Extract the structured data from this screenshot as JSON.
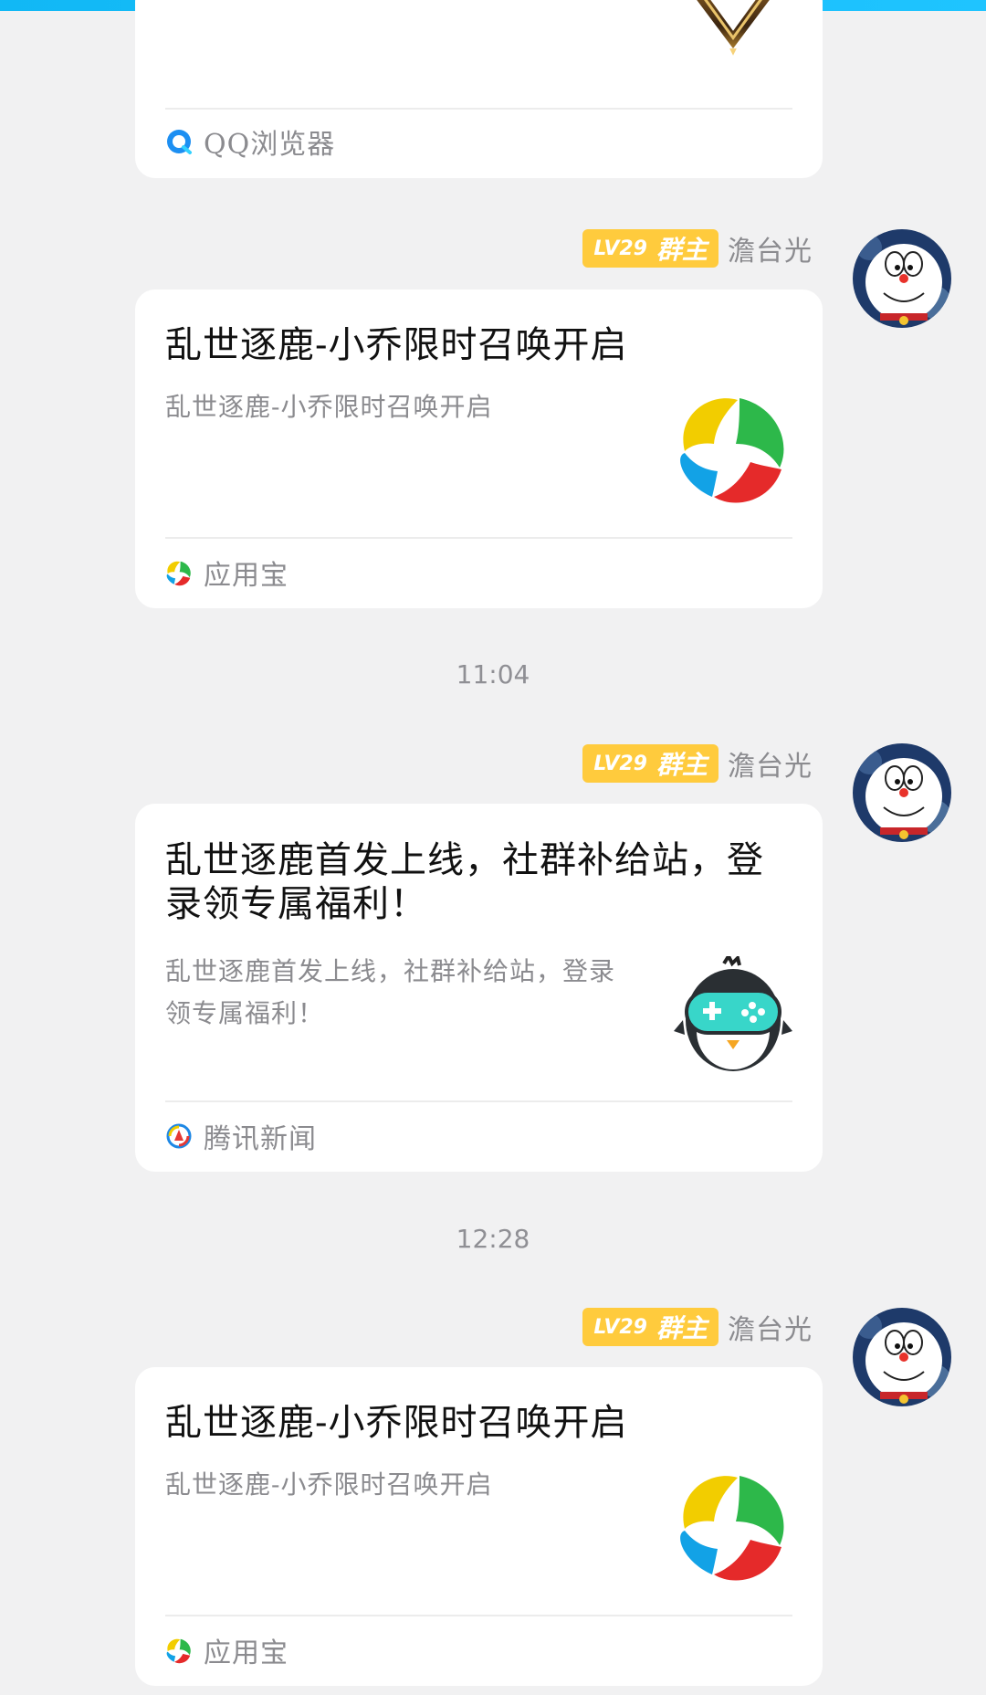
{
  "cards": [
    {
      "source": "QQ浏览器",
      "source_icon": "qq-browser-icon"
    },
    {
      "title": "乱世逐鹿-小乔限时召唤开启",
      "description": "乱世逐鹿-小乔限时召唤开启",
      "source": "应用宝",
      "thumb_icon": "yingyongbao-logo-icon",
      "source_icon": "yingyongbao-icon"
    },
    {
      "title": "乱世逐鹿首发上线，社群补给站，登录领专属福利！",
      "description": "乱世逐鹿首发上线，社群补给站，登录领专属福利！",
      "source": "腾讯新闻",
      "thumb_icon": "game-penguin-icon",
      "source_icon": "tencent-news-icon"
    },
    {
      "title": "乱世逐鹿-小乔限时召唤开启",
      "description": "乱世逐鹿-小乔限时召唤开启",
      "source": "应用宝",
      "thumb_icon": "yingyongbao-logo-icon",
      "source_icon": "yingyongbao-icon"
    }
  ],
  "sender": {
    "level": "LV29",
    "role": "群主",
    "name": "澹台光",
    "badge_color": "#ffcb3d"
  },
  "timestamps": [
    "11:04",
    "12:28"
  ],
  "colors": {
    "accent": "#1fc4ff",
    "background": "#f1f1f2"
  }
}
